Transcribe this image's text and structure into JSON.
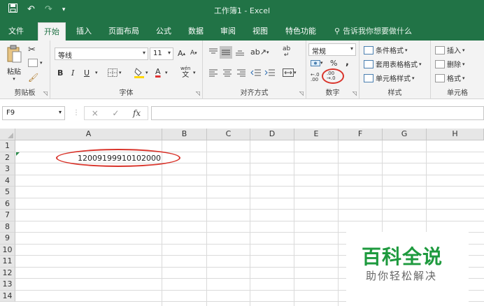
{
  "titlebar": {
    "save_icon": "save-icon",
    "undo": "↶",
    "redo": "↷",
    "customize": "▾",
    "title": "工作簿1  -  Excel"
  },
  "tabs": [
    "文件",
    "开始",
    "插入",
    "页面布局",
    "公式",
    "数据",
    "审阅",
    "视图",
    "特色功能"
  ],
  "active_tab": "开始",
  "tellme": "告诉我你想要做什么",
  "ribbon": {
    "clipboard": {
      "label": "剪贴板",
      "paste": "粘贴"
    },
    "font": {
      "label": "字体",
      "font_name": "等线",
      "font_size": "11",
      "grow": "A",
      "shrink": "A",
      "bold": "B",
      "italic": "I",
      "underline": "U",
      "phonetic": "wén",
      "phonetic_char": "文"
    },
    "alignment": {
      "label": "对齐方式",
      "wrap": "ab"
    },
    "number": {
      "label": "数字",
      "format": "常规",
      "percent": "%",
      "comma": ",",
      "inc_decimal": ".00",
      "dec_decimal": ".0"
    },
    "styles": {
      "label": "样式",
      "conditional": "条件格式",
      "table": "套用表格格式",
      "cell_styles": "单元格样式"
    },
    "cells": {
      "label": "单元格",
      "insert": "插入",
      "delete": "删除",
      "format": "格式"
    }
  },
  "formula_bar": {
    "name_box": "F9",
    "cancel": "×",
    "enter": "✓",
    "fx": "fx",
    "content": ""
  },
  "sheet": {
    "columns": [
      "A",
      "B",
      "C",
      "D",
      "E",
      "F",
      "G",
      "H"
    ],
    "rows": [
      "1",
      "2",
      "3",
      "4",
      "5",
      "6",
      "7",
      "8",
      "9",
      "10",
      "11",
      "12",
      "13",
      "14"
    ],
    "cell_a2": "12009199910102000"
  },
  "watermark": {
    "title": "百科全说",
    "subtitle": "助你轻松解决"
  },
  "colors": {
    "excel_green": "#217346",
    "highlight_red": "#d9342b",
    "watermark_green": "#1e9a3e"
  }
}
